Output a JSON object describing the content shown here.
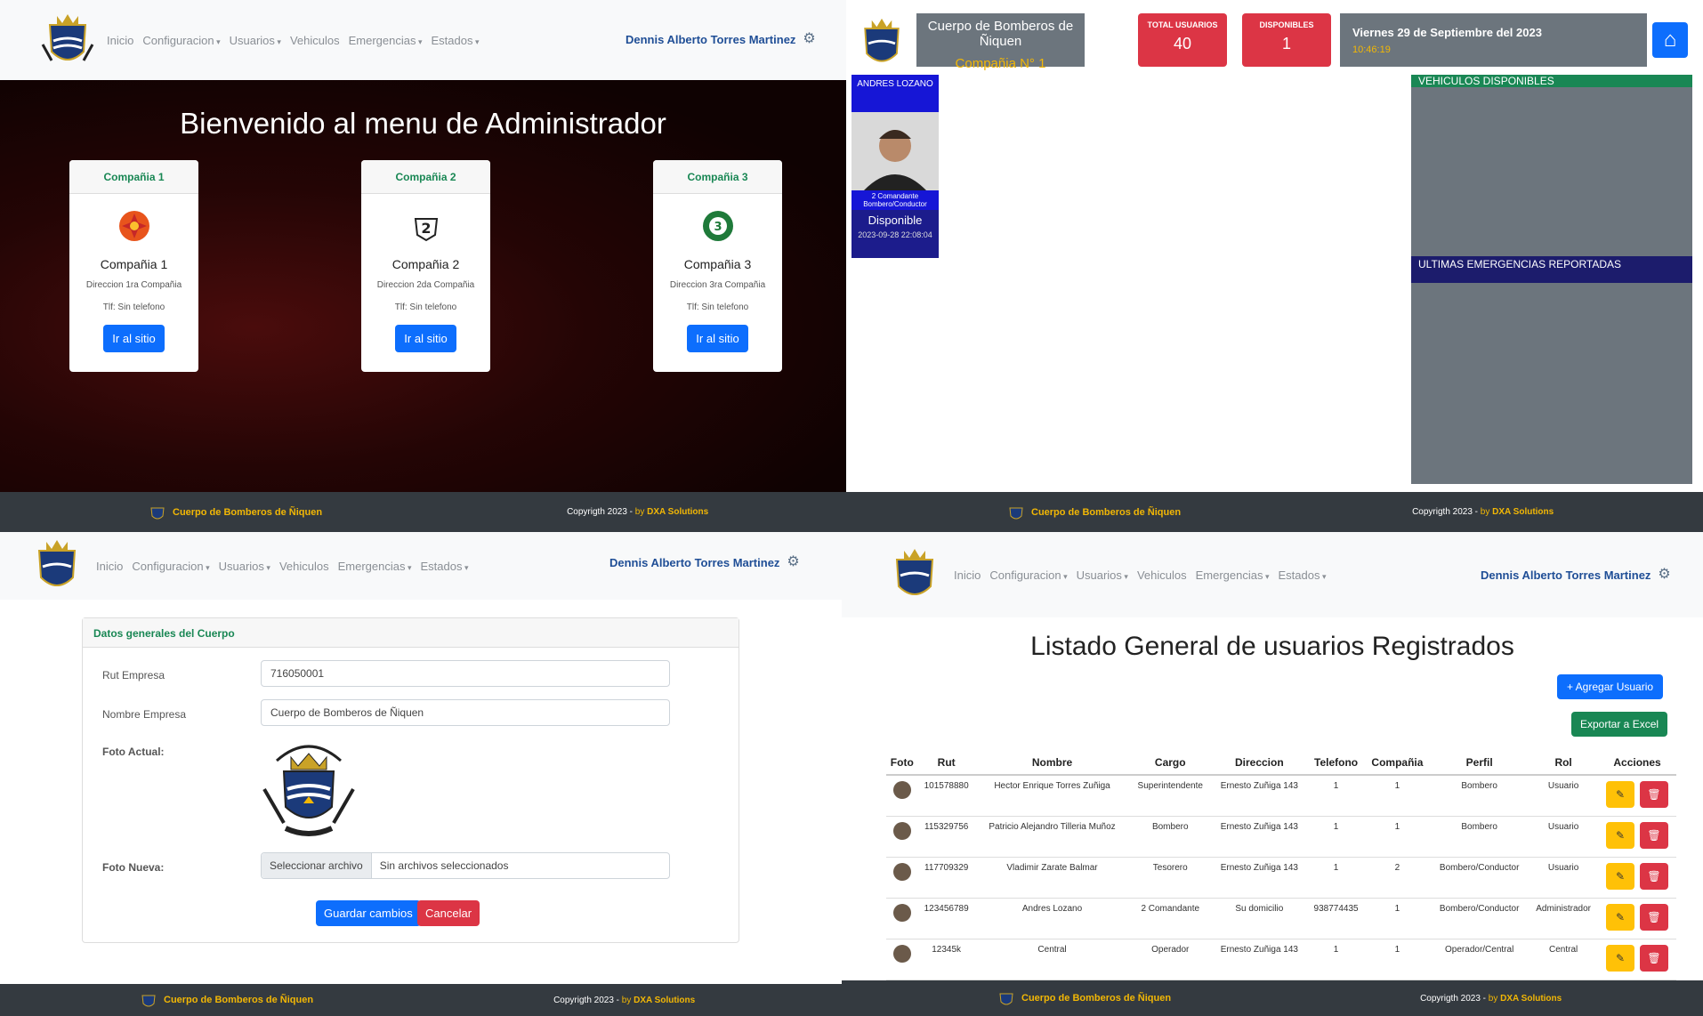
{
  "nav": {
    "items": [
      {
        "label": "Inicio",
        "dropdown": false
      },
      {
        "label": "Configuracion",
        "dropdown": true
      },
      {
        "label": "Usuarios",
        "dropdown": true
      },
      {
        "label": "Vehiculos",
        "dropdown": false
      },
      {
        "label": "Emergencias",
        "dropdown": true
      },
      {
        "label": "Estados",
        "dropdown": true
      }
    ],
    "user_name": "Dennis Alberto Torres Martinez"
  },
  "footer": {
    "brand": "Cuerpo de Bomberos de Ñiquen",
    "copyright": "Copyrigth 2023 - ",
    "by": "by",
    "company": "DXA Solutions"
  },
  "admin_menu": {
    "title": "Bienvenido al menu de Administrador",
    "cards": [
      {
        "header": "Compañia 1",
        "name": "Compañia 1",
        "address": "Direccion 1ra Compañia",
        "phone": "Tlf: Sin telefono",
        "button": "Ir al sitio",
        "logo_color": "#e8541c",
        "logo_text": "1"
      },
      {
        "header": "Compañia 2",
        "name": "Compañia 2",
        "address": "Direccion 2da Compañia",
        "phone": "Tlf: Sin telefono",
        "button": "Ir al sitio",
        "logo_color": "#222222",
        "logo_text": "2"
      },
      {
        "header": "Compañia 3",
        "name": "Compañia 3",
        "address": "Direccion 3ra Compañia",
        "phone": "Tlf: Sin telefono",
        "button": "Ir al sitio",
        "logo_color": "#1f7a3a",
        "logo_text": "3"
      }
    ]
  },
  "dashboard": {
    "org_name": "Cuerpo de Bomberos de Ñiquen",
    "company": "Compañia N° 1",
    "total_users_label": "TOTAL USUARIOS",
    "total_users": "40",
    "available_label": "DISPONIBLES",
    "available": "1",
    "date": "Viernes 29 de Septiembre del 2023",
    "time": "10:46:19",
    "person": {
      "name": "ANDRES LOZANO",
      "rank": "2 Comandante",
      "role": "Bombero/Conductor",
      "status": "Disponible",
      "timestamp": "2023-09-28 22:08:04"
    },
    "vehicles_header": "VEHICULOS DISPONIBLES",
    "emergencies_header": "ULTIMAS EMERGENCIAS REPORTADAS"
  },
  "settings_form": {
    "header": "Datos generales del Cuerpo",
    "rut_label": "Rut Empresa",
    "rut_value": "716050001",
    "name_label": "Nombre Empresa",
    "name_value": "Cuerpo de Bomberos de Ñiquen",
    "photo_current_label": "Foto Actual:",
    "photo_new_label": "Foto Nueva:",
    "file_button": "Seleccionar archivo",
    "file_status": "Sin archivos seleccionados",
    "save_button": "Guardar cambios",
    "cancel_button": "Cancelar"
  },
  "users_list": {
    "title": "Listado General de usuarios Registrados",
    "add_button": "+ Agregar Usuario",
    "export_button": "Exportar a Excel",
    "columns": [
      "Foto",
      "Rut",
      "Nombre",
      "Cargo",
      "Direccion",
      "Telefono",
      "Compañia",
      "Perfil",
      "Rol",
      "Acciones"
    ],
    "rows": [
      {
        "rut": "101578880",
        "nombre": "Hector Enrique Torres Zuñiga",
        "cargo": "Superintendente",
        "direccion": "Ernesto Zuñiga 143",
        "telefono": "1",
        "compania": "1",
        "perfil": "Bombero",
        "rol": "Usuario"
      },
      {
        "rut": "115329756",
        "nombre": "Patricio Alejandro Tilleria Muñoz",
        "cargo": "Bombero",
        "direccion": "Ernesto Zuñiga 143",
        "telefono": "1",
        "compania": "1",
        "perfil": "Bombero",
        "rol": "Usuario"
      },
      {
        "rut": "117709329",
        "nombre": "Vladimir Zarate Balmar",
        "cargo": "Tesorero",
        "direccion": "Ernesto Zuñiga 143",
        "telefono": "1",
        "compania": "2",
        "perfil": "Bombero/Conductor",
        "rol": "Usuario"
      },
      {
        "rut": "123456789",
        "nombre": "Andres Lozano",
        "cargo": "2 Comandante",
        "direccion": "Su domicilio",
        "telefono": "938774435",
        "compania": "1",
        "perfil": "Bombero/Conductor",
        "rol": "Administrador"
      },
      {
        "rut": "12345k",
        "nombre": "Central",
        "cargo": "Operador",
        "direccion": "Ernesto Zuñiga 143",
        "telefono": "1",
        "compania": "1",
        "perfil": "Operador/Central",
        "rol": "Central"
      }
    ]
  },
  "colors": {
    "primary": "#0d6efd",
    "success": "#198754",
    "danger": "#dc3545",
    "warning": "#ffc107",
    "footer": "#343a40",
    "brand_gold": "#f2b705"
  },
  "icons": [
    "crest-logo",
    "gear-icon",
    "home-icon",
    "edit-icon",
    "trash-icon"
  ]
}
